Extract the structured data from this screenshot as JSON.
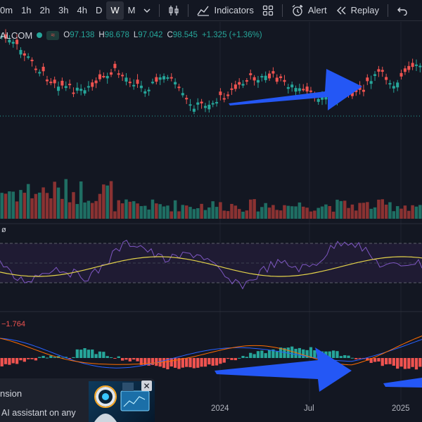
{
  "toolbar": {
    "timeframes": [
      "0m",
      "1h",
      "2h",
      "3h",
      "4h",
      "D",
      "W",
      "M"
    ],
    "active_timeframe": "W",
    "indicators_label": "Indicators",
    "alert_label": "Alert",
    "replay_label": "Replay",
    "icons": [
      "chevron-down-icon",
      "candles-icon",
      "indicators-icon",
      "templates-icon",
      "alert-icon",
      "replay-icon",
      "undo-icon"
    ]
  },
  "legend": {
    "symbol": "ALCOM",
    "open_label": "O",
    "open": "97.138",
    "high_label": "H",
    "high": "98.678",
    "low_label": "L",
    "low": "97.042",
    "close_label": "C",
    "close": "98.545",
    "change": "+1.325 (+1.36%)"
  },
  "rsi_pane": {
    "label": "ø"
  },
  "macd_pane": {
    "value": "−1.764"
  },
  "date_axis": [
    "2024",
    "Jul",
    "2025"
  ],
  "promo": {
    "title": "nsion",
    "body": "AI assistant on any",
    "close_icon": "close-icon"
  },
  "colors": {
    "up": "#26a69a",
    "down": "#ef5350",
    "rsi": "#7e57c2",
    "rsi_ma": "#e4d34a",
    "macd": "#2962ff",
    "signal": "#ff6d00",
    "arrow": "#2457f5"
  },
  "chart_data": {
    "type": "candlestick",
    "price_y": [
      97.138,
      98.678,
      97.042,
      98.545
    ],
    "x_labels": [
      "2024",
      "Jul",
      "2025"
    ]
  }
}
